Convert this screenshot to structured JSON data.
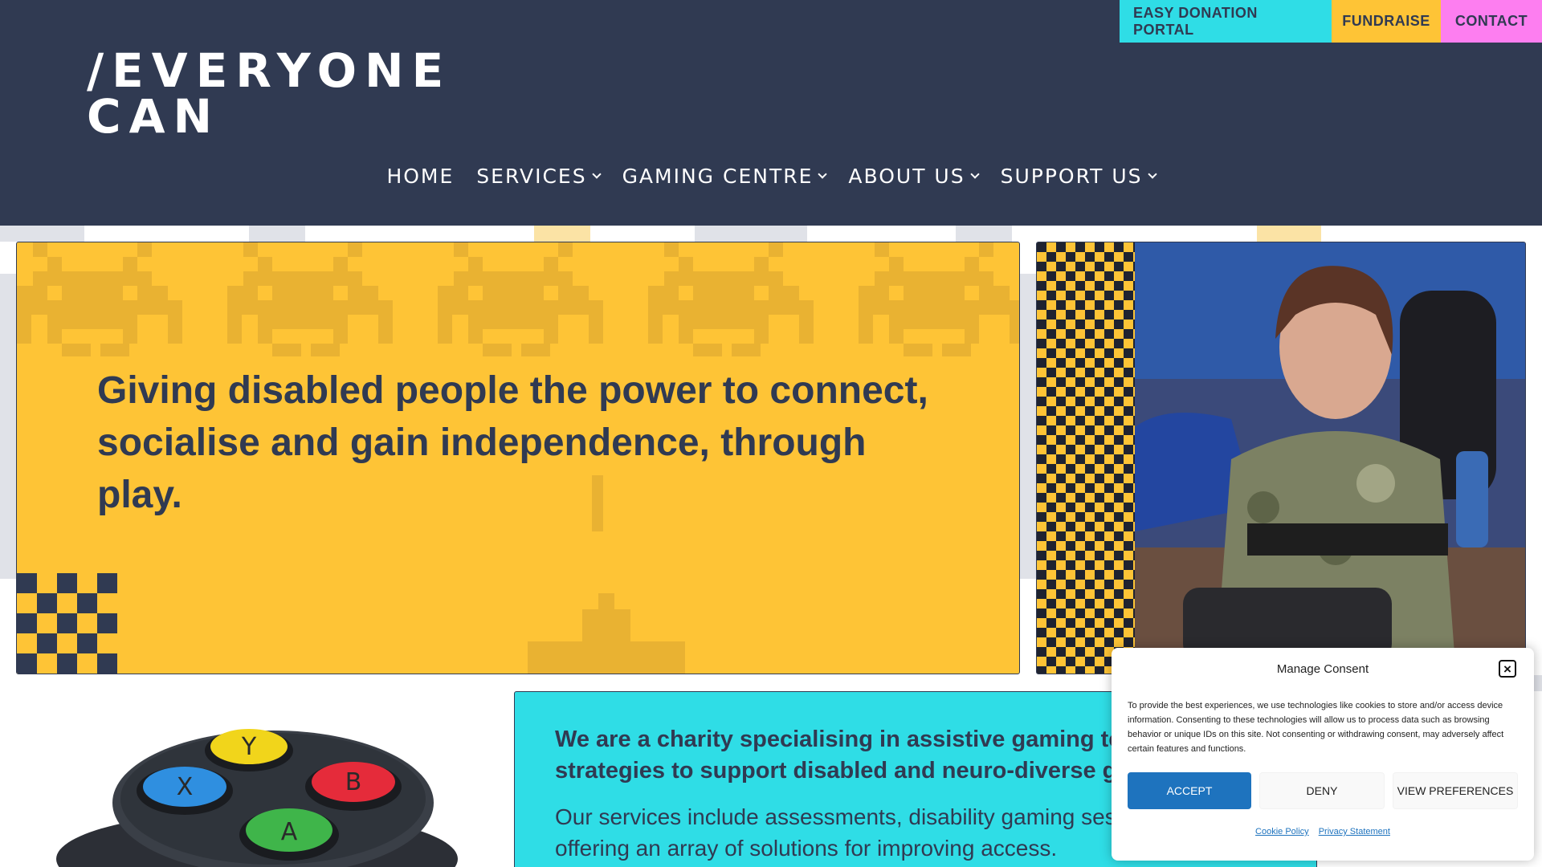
{
  "header": {
    "logo_line1": "/EVERYONE",
    "logo_line2": "CAN",
    "top_buttons": {
      "donate": "EASY DONATION PORTAL",
      "fundraise": "FUNDRAISE",
      "contact": "CONTACT"
    },
    "nav": {
      "home": "HOME",
      "services": "SERVICES",
      "gaming_centre": "GAMING CENTRE",
      "about_us": "ABOUT US",
      "support_us": "SUPPORT US"
    }
  },
  "hero": {
    "headline": "Giving disabled people the power to connect, socialise and gain independence, through play."
  },
  "info": {
    "lead": "We are a charity specialising in assistive gaming technology and gaming strategies to support disabled and neuro-diverse gamers.",
    "body": "Our services include assessments, disability gaming sessions and controller design, offering an array of solutions for improving access."
  },
  "gamepad": {
    "buttons": [
      "Y",
      "X",
      "B",
      "A"
    ]
  },
  "consent": {
    "title": "Manage Consent",
    "text": "To provide the best experiences, we use technologies like cookies to store and/or access device information. Consenting to these technologies will allow us to process data such as browsing behavior or unique IDs on this site. Not consenting or withdrawing consent, may adversely affect certain features and functions.",
    "accept": "ACCEPT",
    "deny": "DENY",
    "preferences": "VIEW PREFERENCES",
    "cookie_policy": "Cookie Policy",
    "privacy_statement": "Privacy Statement"
  },
  "colors": {
    "navy": "#303a52",
    "yellow": "#fec436",
    "cyan": "#2fdde6",
    "pink": "#fd7ef0",
    "accept_blue": "#1e73be"
  }
}
